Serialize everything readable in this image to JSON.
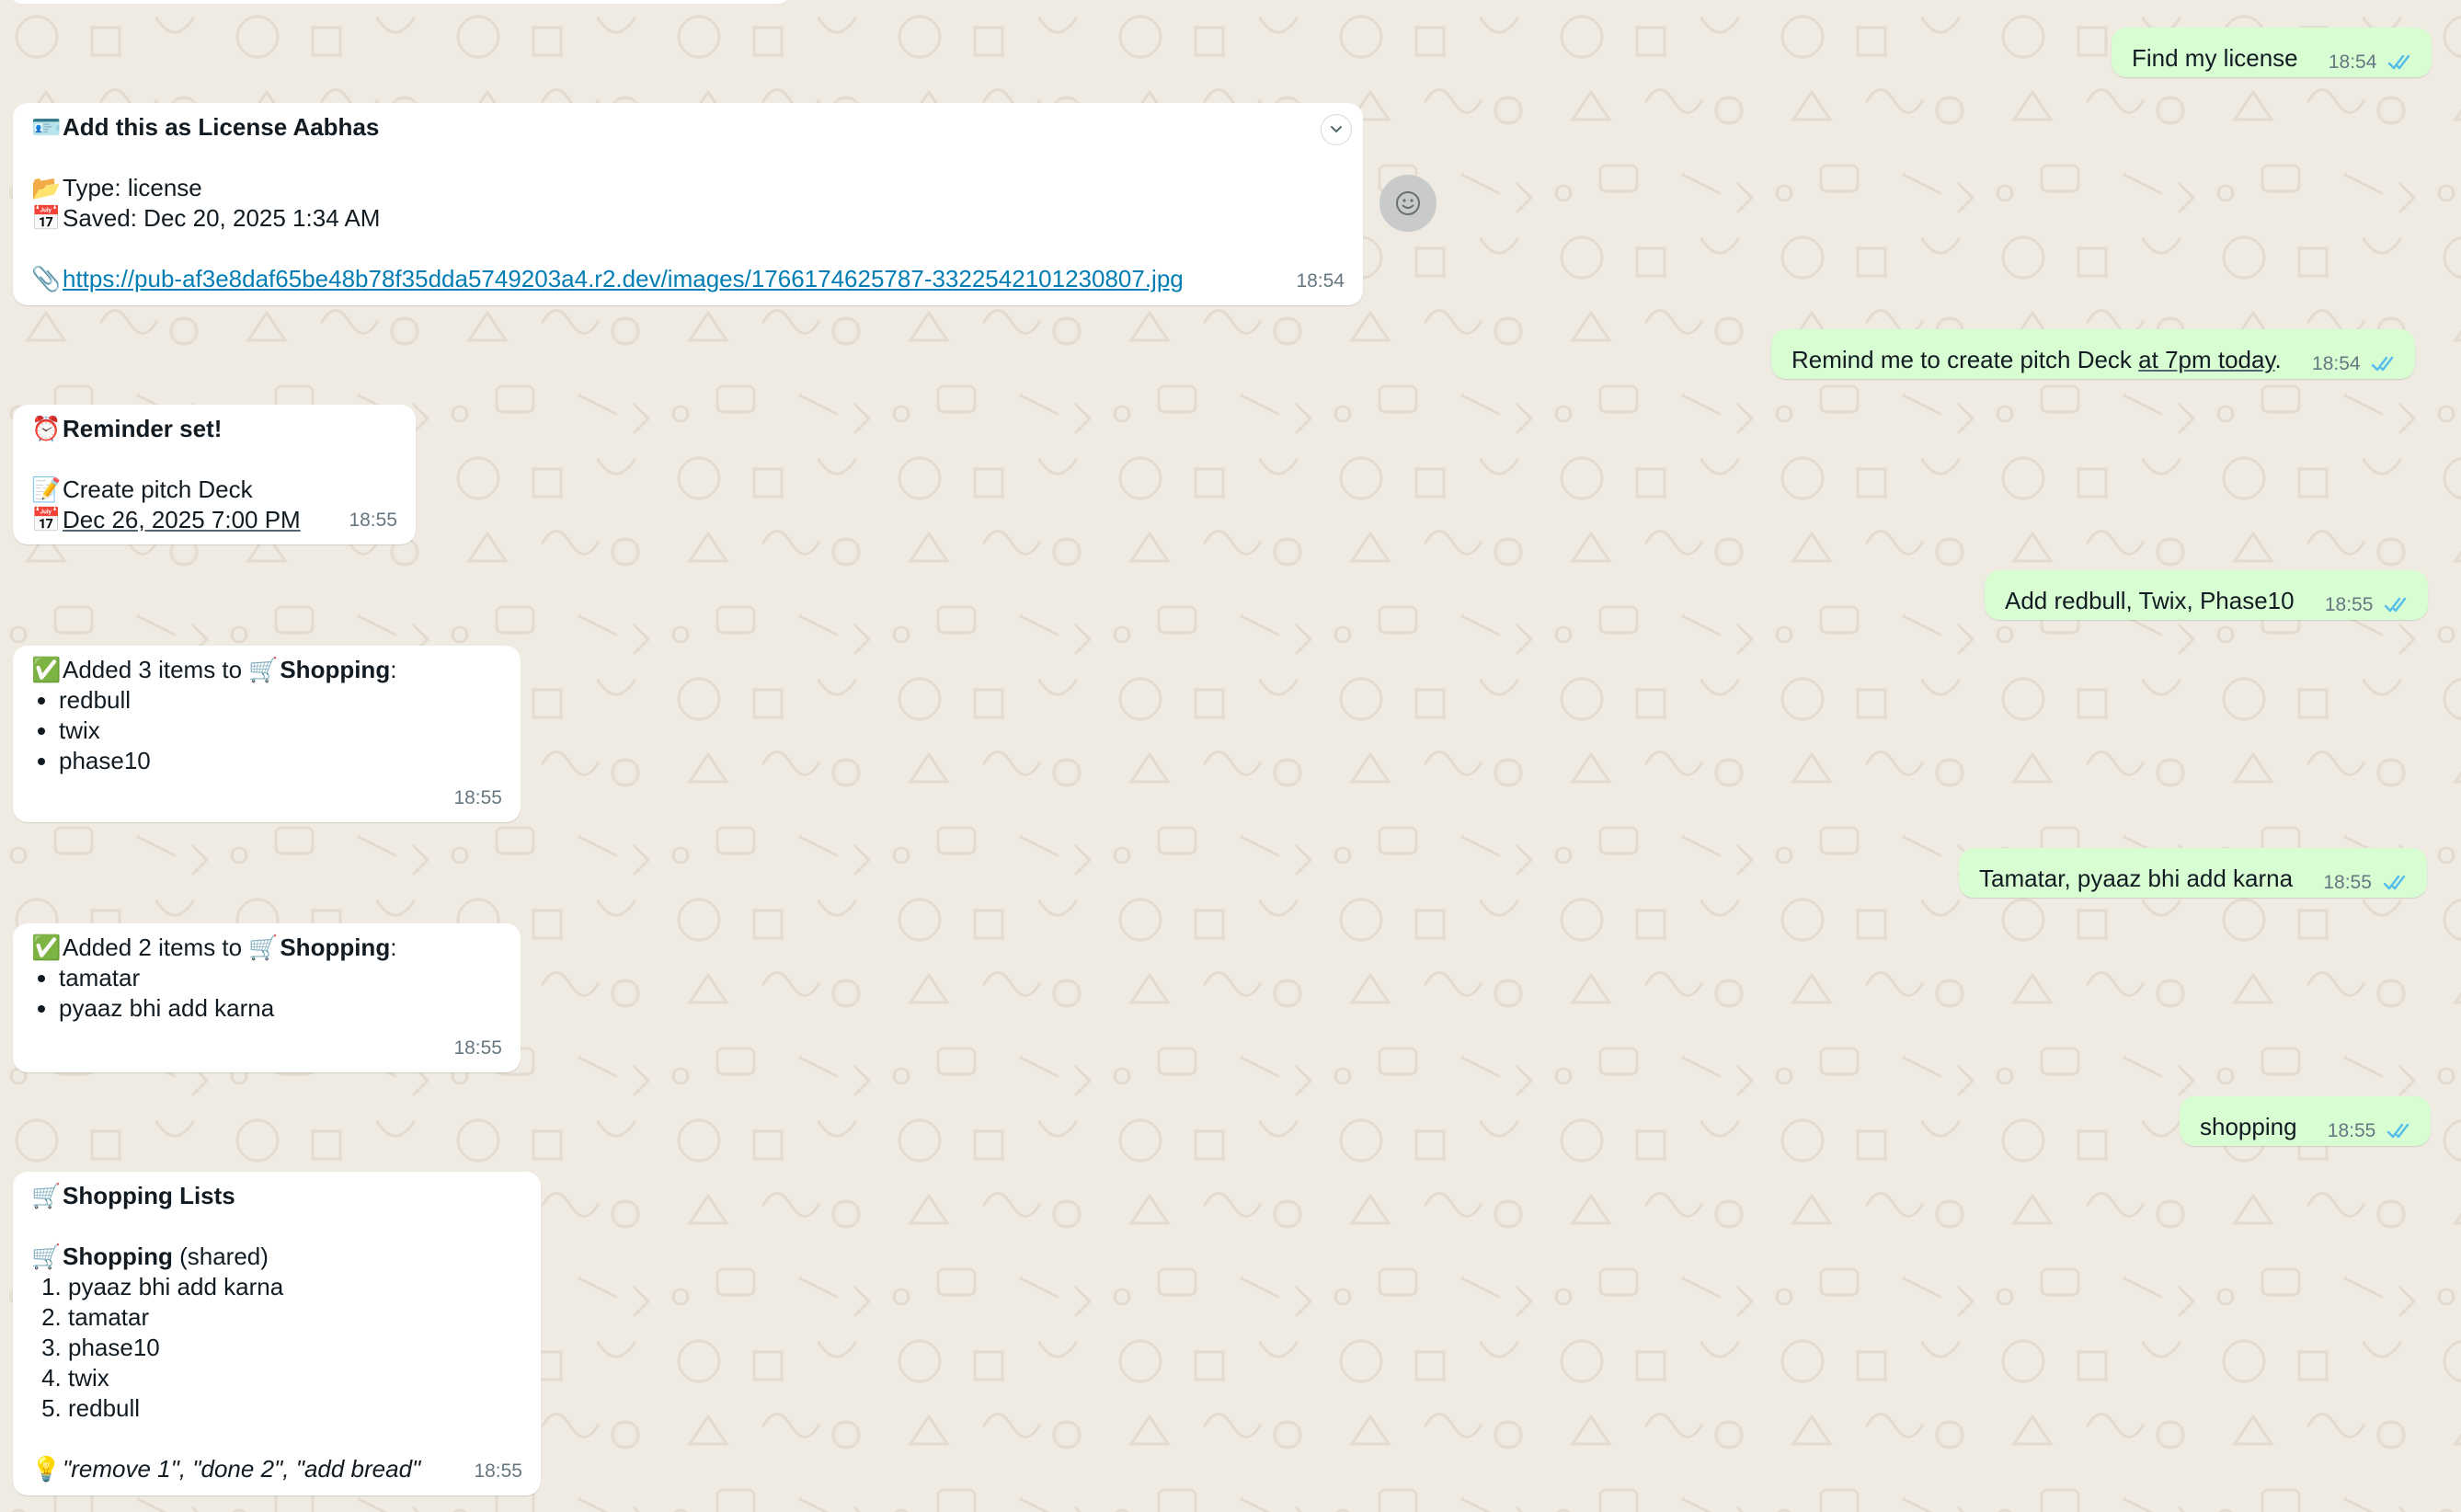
{
  "outgoing": [
    {
      "text": "Find my license",
      "time": "18:54"
    },
    {
      "text_before": "Remind me to create pitch Deck ",
      "text_under": "at 7pm today",
      "text_after": ".",
      "time": "18:54"
    },
    {
      "text": "Add redbull, Twix, Phase10",
      "time": "18:55"
    },
    {
      "text": "Tamatar, pyaaz bhi add karna",
      "time": "18:55"
    },
    {
      "text": "shopping",
      "time": "18:55"
    }
  ],
  "license_msg": {
    "title_emoji": "🪪",
    "title": "Add this as License Aabhas",
    "type_emoji": "📂",
    "type_text": "Type: license",
    "saved_emoji": "📅",
    "saved_text": "Saved: Dec 20, 2025 1:34 AM",
    "link_emoji": "📎",
    "link": "https://pub-af3e8daf65be48b78f35dda5749203a4.r2.dev/images/1766174625787-3322542101230807.jpg",
    "time": "18:54"
  },
  "reminder_msg": {
    "title_emoji": "⏰",
    "title": "Reminder set!",
    "task_emoji": "📝",
    "task": "Create pitch Deck",
    "date_emoji": "📅",
    "date": "Dec 26, 2025 7:00 PM",
    "time": "18:55"
  },
  "added3_msg": {
    "check_emoji": "✅",
    "prefix": "Added 3 items to ",
    "cart_emoji": "🛒",
    "list_name": "Shopping",
    "colon": ":",
    "items": [
      "redbull",
      "twix",
      "phase10"
    ],
    "time": "18:55"
  },
  "added2_msg": {
    "check_emoji": "✅",
    "prefix": "Added 2 items to ",
    "cart_emoji": "🛒",
    "list_name": "Shopping",
    "colon": ":",
    "items": [
      "tamatar",
      "pyaaz bhi add karna"
    ],
    "time": "18:55"
  },
  "lists_msg": {
    "title_emoji": "🛒",
    "title": "Shopping Lists",
    "list_emoji": "🛒",
    "list_name": "Shopping",
    "list_suffix": " (shared)",
    "items": [
      "pyaaz bhi add karna",
      "tamatar",
      "phase10",
      "twix",
      "redbull"
    ],
    "hint_emoji": "💡",
    "hint": "\"remove 1\", \"done 2\", \"add bread\"",
    "time": "18:55"
  },
  "colors": {
    "background": "#efeae2",
    "incoming": "#ffffff",
    "outgoing": "#d9fdd3",
    "tick_read": "#53bdeb",
    "link": "#027eb5"
  },
  "icons": {
    "read_ticks": "double-check-icon",
    "expand": "chevron-down-icon",
    "react": "emoji-smiley-icon"
  }
}
